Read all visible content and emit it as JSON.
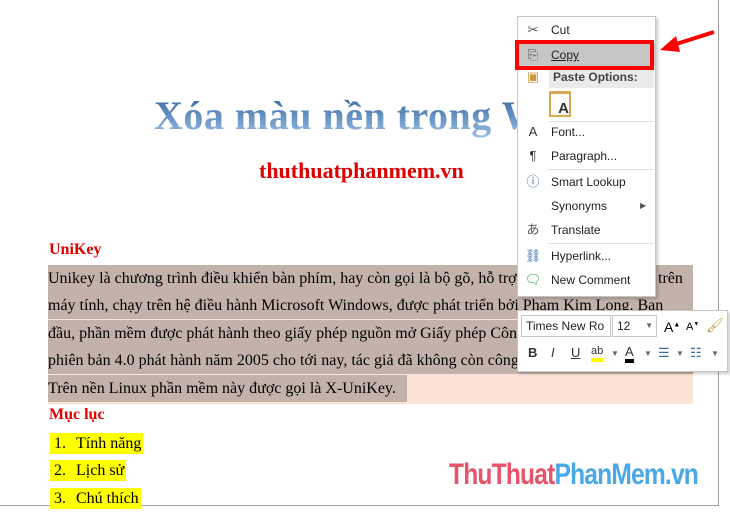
{
  "document": {
    "title": "Xóa màu nền trong Wo",
    "subtitle": "thuthuatphanmem.vn",
    "heading1": "UniKey",
    "paragraph_lines": [
      {
        "left": "Unikey là chương trình điều khiển bàn phím, hay còn gọi là bộ gõ, hỗ trợ",
        "right": "trên"
      },
      {
        "left": "máy tính, chạy trên hệ điều hành Microsoft Windows, được phát triển bởi Phạm Kim Long. Ban",
        "right": ""
      },
      {
        "left": "đầu, phần mềm được phát hành theo giấy phép nguồn mở Giấy phép Côn",
        "right": ""
      },
      {
        "left": "phiên bản 4.0 phát hành năm 2005 cho tới nay, tác giả đã không còn công",
        "right": ""
      },
      {
        "left": "Trên nền Linux phần mềm này được gọi là X-UniKey.",
        "right": ""
      }
    ],
    "heading2": "Mục lục",
    "list": [
      {
        "num": "1.",
        "text": "Tính năng"
      },
      {
        "num": "2.",
        "text": "Lịch sử"
      },
      {
        "num": "3.",
        "text": "Chú thích"
      }
    ]
  },
  "context_menu": {
    "items": [
      {
        "label": "Cut",
        "icon": "scissors-icon"
      },
      {
        "label": "Copy",
        "icon": "copy-icon",
        "highlighted": true
      },
      {
        "label": "Paste Options:",
        "icon": "paste-icon"
      },
      {
        "label": "Font...",
        "icon": "font-icon"
      },
      {
        "label": "Paragraph...",
        "icon": "paragraph-icon"
      },
      {
        "label": "Smart Lookup",
        "icon": "smart-lookup-icon"
      },
      {
        "label": "Synonyms",
        "icon": "submenu-arrow-icon"
      },
      {
        "label": "Translate",
        "icon": "translate-icon"
      },
      {
        "label": "Hyperlink...",
        "icon": "hyperlink-icon"
      },
      {
        "label": "New Comment",
        "icon": "new-comment-icon"
      }
    ]
  },
  "mini_toolbar": {
    "font": "Times New Ro",
    "size": "12",
    "bold": "B",
    "italic": "I",
    "underline": "U",
    "font_color_letter": "A"
  },
  "watermark": {
    "part1": "ThuThuat",
    "part2": "PhanMem.vn",
    "color1": "#e8536c",
    "color2": "#4aa8e8"
  },
  "colors": {
    "heading": "#e00000",
    "selection": "#c3b2a9",
    "shading": "#fbe3d7",
    "highlight": "#ffff00",
    "annotation": "#ff0000"
  }
}
